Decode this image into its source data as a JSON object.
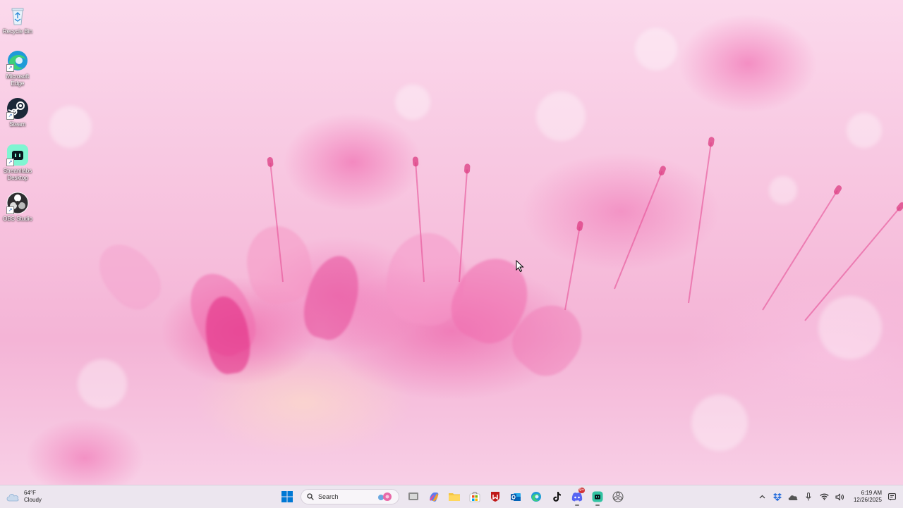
{
  "desktop": {
    "icons": [
      {
        "label": "Recycle Bin",
        "icon": "recycle-bin-icon"
      },
      {
        "label": "Microsoft Edge",
        "icon": "edge-icon"
      },
      {
        "label": "Steam",
        "icon": "steam-icon"
      },
      {
        "label": "Streamlabs Desktop",
        "icon": "streamlabs-icon"
      },
      {
        "label": "OBS Studio",
        "icon": "obs-icon"
      }
    ]
  },
  "taskbar": {
    "weather": {
      "temperature": "64°F",
      "condition": "Cloudy",
      "icon": "cloud-icon"
    },
    "search": {
      "placeholder": "Search"
    },
    "apps": [
      {
        "name": "start",
        "icon": "windows-start-icon"
      },
      {
        "name": "task-view",
        "icon": "task-view-icon"
      },
      {
        "name": "copilot",
        "icon": "copilot-icon"
      },
      {
        "name": "file-explorer",
        "icon": "folder-icon"
      },
      {
        "name": "microsoft-store",
        "icon": "store-icon"
      },
      {
        "name": "mcafee",
        "icon": "mcafee-icon"
      },
      {
        "name": "outlook",
        "icon": "outlook-icon"
      },
      {
        "name": "edge",
        "icon": "edge-icon"
      },
      {
        "name": "tiktok",
        "icon": "tiktok-icon"
      },
      {
        "name": "discord",
        "icon": "discord-icon",
        "badge": "9+"
      },
      {
        "name": "streamlabs",
        "icon": "streamlabs-icon"
      },
      {
        "name": "obs",
        "icon": "obs-icon"
      }
    ],
    "tray": {
      "icons": [
        "chevron-up-icon",
        "dropbox-icon",
        "onedrive-icon",
        "microphone-icon",
        "wifi-icon",
        "speaker-icon",
        "notification-icon"
      ],
      "time": "6:19 AM",
      "date": "12/26/2025"
    }
  },
  "colors": {
    "taskbar_bg": "#ece6ef",
    "wallpaper_pink": "#f4b4d6",
    "accent_blue": "#0078d4"
  }
}
